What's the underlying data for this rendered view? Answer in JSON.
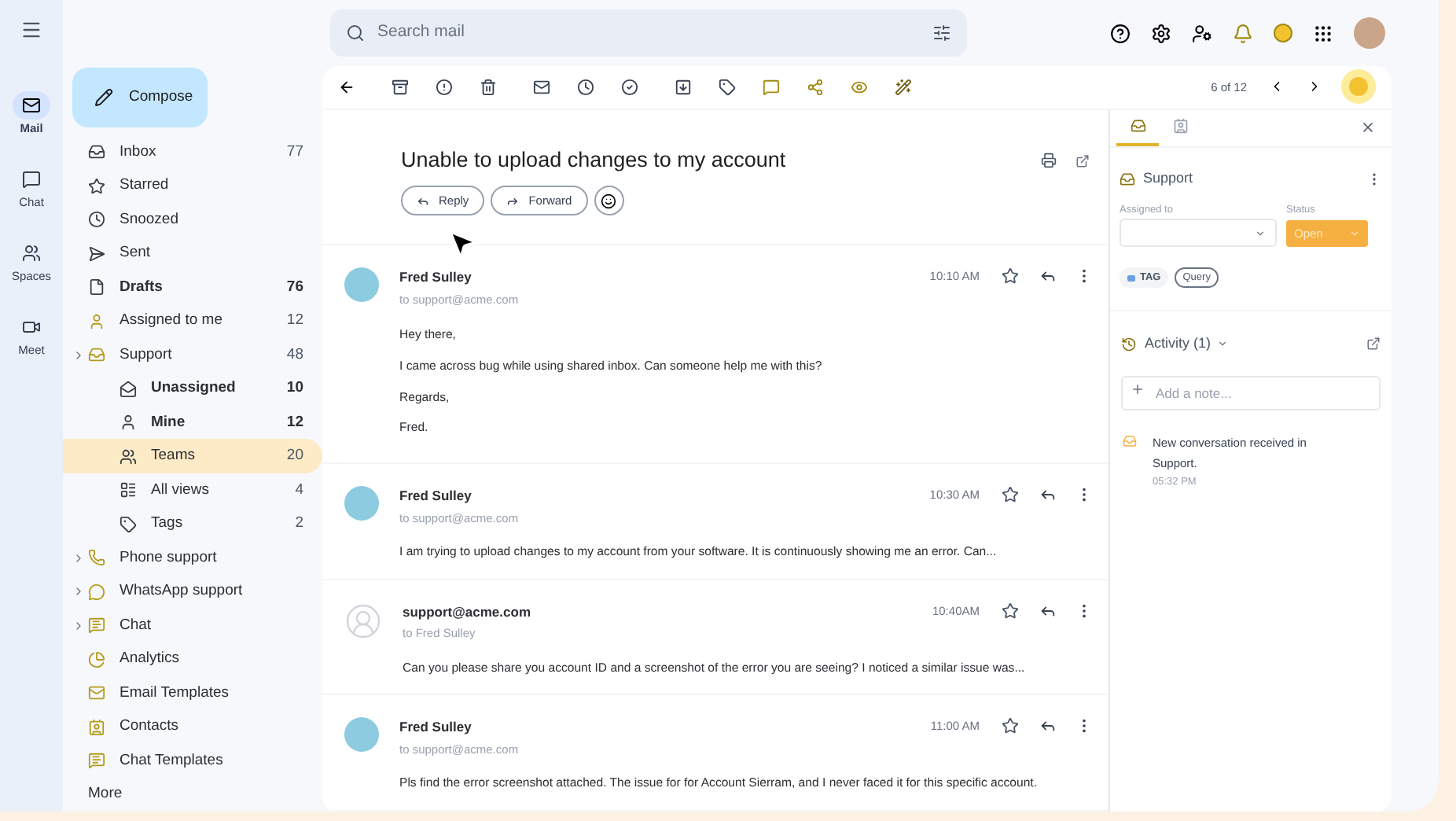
{
  "search": {
    "placeholder": "Search mail"
  },
  "rail": [
    {
      "label": "Mail",
      "selected": true
    },
    {
      "label": "Chat",
      "selected": false
    },
    {
      "label": "Spaces",
      "selected": false
    },
    {
      "label": "Meet",
      "selected": false
    }
  ],
  "compose": "Compose",
  "sidebar": {
    "items": [
      {
        "label": "Inbox",
        "count": "77",
        "bold": false,
        "selected": false
      },
      {
        "label": "Starred",
        "bold": false,
        "selected": false
      },
      {
        "label": "Snoozed",
        "bold": false,
        "selected": false
      },
      {
        "label": "Sent",
        "bold": false,
        "selected": false
      },
      {
        "label": "Drafts",
        "count": "76",
        "bold": true,
        "selected": false
      },
      {
        "label": "Assigned to me",
        "count": "12",
        "bold": false,
        "selected": false
      },
      {
        "label": "Support",
        "count": "48",
        "bold": false,
        "selected": false,
        "expandable": true,
        "children": [
          {
            "label": "Unassigned",
            "count": "10",
            "bold": true,
            "selected": false
          },
          {
            "label": "Mine",
            "count": "12",
            "bold": true,
            "selected": false
          },
          {
            "label": "Teams",
            "count": "20",
            "bold": false,
            "selected": true
          },
          {
            "label": "All views",
            "count": "4",
            "bold": false,
            "selected": false
          },
          {
            "label": "Tags",
            "count": "2",
            "bold": false,
            "selected": false
          }
        ]
      },
      {
        "label": "Phone support",
        "bold": false,
        "selected": false,
        "expandable": true
      },
      {
        "label": "WhatsApp support",
        "bold": false,
        "selected": false,
        "expandable": true
      },
      {
        "label": "Chat",
        "bold": false,
        "selected": false,
        "expandable": true
      },
      {
        "label": "Analytics",
        "bold": false,
        "selected": false
      },
      {
        "label": "Email Templates",
        "bold": false,
        "selected": false
      },
      {
        "label": "Contacts",
        "bold": false,
        "selected": false
      },
      {
        "label": "Chat Templates",
        "bold": false,
        "selected": false
      },
      {
        "label": "More",
        "bold": false,
        "selected": false,
        "kind": "more"
      }
    ]
  },
  "toolbar": {
    "pager": "6 of 12"
  },
  "thread": {
    "subject": "Unable to upload changes to my account",
    "actions": [
      "Reply",
      "Forward"
    ],
    "messages": [
      {
        "sender": "Fred Sulley",
        "to": "to support@acme.com",
        "time": "10:10 AM",
        "kind": "photo",
        "body": [
          "Hey there,",
          "I came across bug while using shared inbox. Can someone help me with this?",
          "Regards,",
          "Fred."
        ]
      },
      {
        "sender": "Fred Sulley",
        "to": "to support@acme.com",
        "time": "10:30 AM",
        "kind": "photo",
        "body": [
          "I am trying to upload changes to my account from your software. It is continuously showing me an error. Can..."
        ]
      },
      {
        "sender": "support@acme.com",
        "to": "to Fred Sulley",
        "time": "10:40AM",
        "kind": "generic",
        "body": [
          "Can you please share you account ID and a screenshot of the error you are seeing? I noticed a similar issue was..."
        ]
      },
      {
        "sender": "Fred Sulley",
        "to": "to support@acme.com",
        "time": "11:00 AM",
        "kind": "photo",
        "body": [
          "Pls find the error screenshot attached. The issue for for Account Sierram, and I never faced it for this specific account."
        ]
      }
    ]
  },
  "panel": {
    "tabs": [
      {
        "selected": true
      },
      {
        "selected": false
      }
    ],
    "title": "Support",
    "assigned_label": "Assigned to",
    "status_label": "Status",
    "status": "Open",
    "tags": [
      {
        "label": "TAG",
        "kind": "tag"
      },
      {
        "label": "Query",
        "kind": "chip"
      }
    ],
    "activity": {
      "title": "Activity (1)",
      "note_placeholder": "Add a note...",
      "entries": [
        {
          "text": "New conversation received in Support.",
          "time": "05:32 PM"
        }
      ]
    }
  }
}
